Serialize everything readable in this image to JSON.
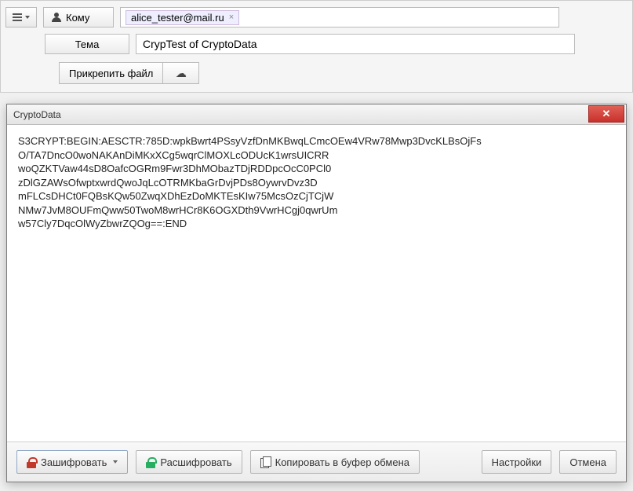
{
  "compose": {
    "to_label": "Кому",
    "recipient": "alice_tester@mail.ru",
    "subject_label": "Тема",
    "subject_value": "CrypTest of CryptoData",
    "attach_label": "Прикрепить файл"
  },
  "dialog": {
    "title": "CryptoData",
    "lines": [
      "S3CRYPT:BEGIN:AESCTR:785D:wpkBwrt4PSsyVzfDnMKBwqLCmcOEw4VRw78Mwp3DvcKLBsOjFs",
      "O/TA7DncO0woNAKAnDiMKxXCg5wqrClMOXLcODUcK1wrsUICRR",
      "woQZKTVaw44sD8OafcOGRm9Fwr3DhMObazTDjRDDpcOcC0PCl0",
      "zDlGZAWsOfwptxwrdQwoJqLcOTRMKbaGrDvjPDs8OywrvDvz3D",
      "mFLCsDHCt0FQBsKQw50ZwqXDhEzDoMKTEsKIw75McsOzCjTCjW",
      "NMw7JvM8OUFmQww50TwoM8wrHCr8K6OGXDth9VwrHCgj0qwrUm",
      "w57Cly7DqcOlWyZbwrZQOg==:END"
    ],
    "buttons": {
      "encrypt": "Зашифровать",
      "decrypt": "Расшифровать",
      "copy": "Копировать в буфер обмена",
      "settings": "Настройки",
      "cancel": "Отмена"
    }
  }
}
